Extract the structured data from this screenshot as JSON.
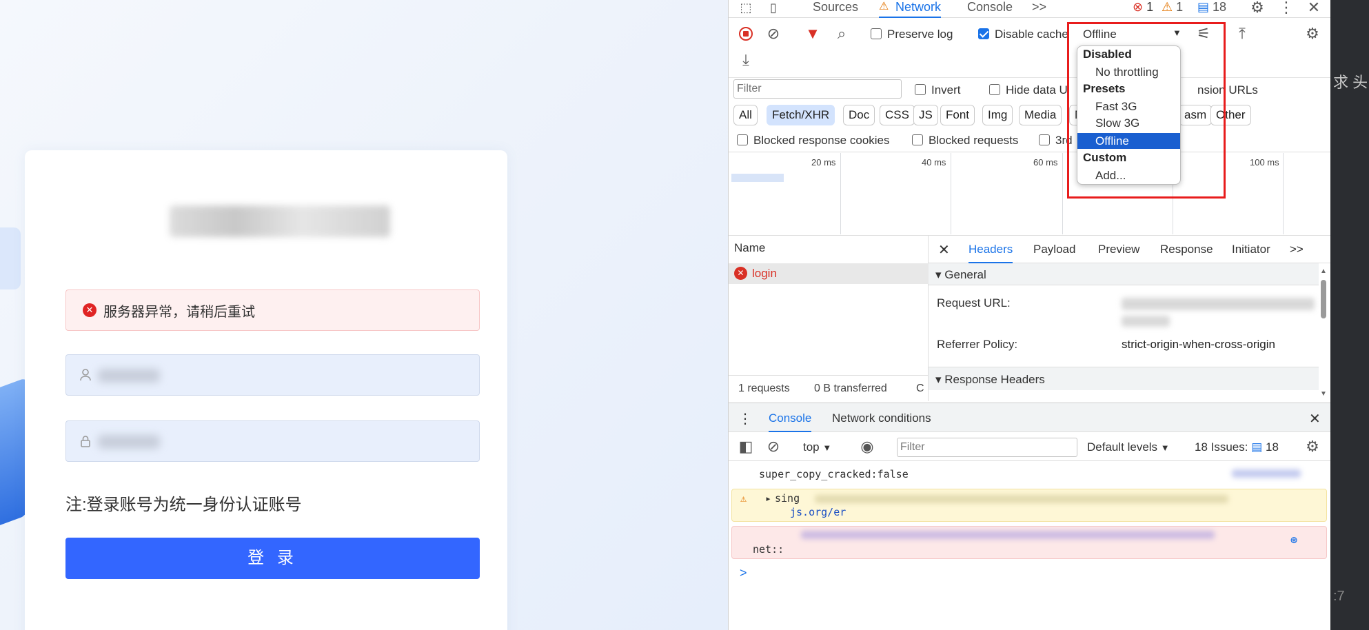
{
  "login": {
    "error_message": "服务器异常，请稍后重试",
    "note": "注:登录账号为统一身份认证账号",
    "login_button": "登 录",
    "username_icon": "user-icon",
    "password_icon": "lock-icon"
  },
  "devtools": {
    "top_tabs": [
      "Sources",
      "Network",
      "Console"
    ],
    "more_tabs": ">>",
    "counts": {
      "errors": "1",
      "warnings": "1",
      "messages": "18"
    },
    "toolbar": {
      "preserve_log": "Preserve log",
      "preserve_log_checked": false,
      "disable_cache": "Disable cache",
      "disable_cache_checked": true,
      "throttling_value": "Offline"
    },
    "filter_placeholder": "Filter",
    "filter_row": {
      "invert": "Invert",
      "hide_data": "Hide data U",
      "extension_urls": "nsion URLs"
    },
    "type_filters": [
      "All",
      "Fetch/XHR",
      "Doc",
      "CSS",
      "JS",
      "Font",
      "Img",
      "Media",
      "M",
      "asm",
      "Other"
    ],
    "active_type_filter": "Fetch/XHR",
    "blocked_row": {
      "blocked_cookies": "Blocked response cookies",
      "blocked_requests": "Blocked requests",
      "third_party": "3rd"
    },
    "timeline_ticks": [
      "20 ms",
      "40 ms",
      "60 ms",
      "100 ms"
    ],
    "throttling_menu": {
      "groups": [
        {
          "heading": "Disabled",
          "items": [
            "No throttling"
          ]
        },
        {
          "heading": "Presets",
          "items": [
            "Fast 3G",
            "Slow 3G",
            "Offline"
          ]
        },
        {
          "heading": "Custom",
          "items": [
            "Add..."
          ]
        }
      ],
      "selected": "Offline"
    },
    "request_list": {
      "header": "Name",
      "rows": [
        {
          "name": "login",
          "status": "error"
        }
      ],
      "footer": {
        "requests": "1 requests",
        "transferred": "0 B transferred",
        "truncated": "C"
      }
    },
    "details": {
      "tabs": [
        "Headers",
        "Payload",
        "Preview",
        "Response",
        "Initiator"
      ],
      "active_tab": "Headers",
      "more": ">>",
      "general_section": "General",
      "fields": [
        {
          "label": "Request URL:",
          "value": ""
        },
        {
          "label": "Referrer Policy:",
          "value": "strict-origin-when-cross-origin"
        }
      ],
      "response_headers_section": "Response Headers"
    },
    "drawer": {
      "tabs": [
        "Console",
        "Network conditions"
      ],
      "active_tab": "Console",
      "context": "top",
      "filter_placeholder": "Filter",
      "levels": "Default levels",
      "issues_label": "18 Issues:",
      "issues_count": "18",
      "messages": [
        {
          "type": "log",
          "text": "super_copy_cracked:false"
        },
        {
          "type": "warning",
          "text": "sing",
          "extra": "js.org/er"
        },
        {
          "type": "error",
          "text": "net::"
        }
      ],
      "prompt": ">"
    }
  },
  "right_strip": {
    "text_top": "求 头",
    "text_bottom": ":7"
  },
  "colors": {
    "accent": "#1a73e8",
    "error": "#d93025",
    "highlight": "#e81c1c",
    "login_button": "#3366ff"
  }
}
